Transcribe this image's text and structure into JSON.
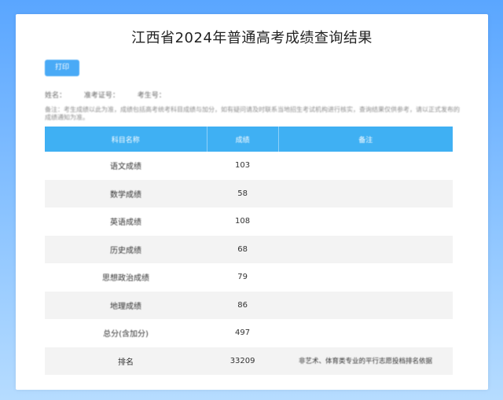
{
  "page": {
    "title": "江西省2024年普通高考成绩查询结果",
    "print_label": "打印",
    "info": {
      "name_label": "姓名：",
      "exam_no_label": "准考证号：",
      "id_label": "考生号："
    },
    "note": "备注：考生成绩以此为准，成绩包括高考统考科目成绩与加分，如有疑问请及时联系当地招生考试机构进行核实，查询结果仅供参考，请以正式发布的成绩通知为准。"
  },
  "table": {
    "headers": [
      "科目名称",
      "成绩",
      "备注"
    ],
    "rows": [
      {
        "subject": "语文成绩",
        "score": "103",
        "note": ""
      },
      {
        "subject": "数学成绩",
        "score": "58",
        "note": ""
      },
      {
        "subject": "英语成绩",
        "score": "108",
        "note": ""
      },
      {
        "subject": "历史成绩",
        "score": "68",
        "note": ""
      },
      {
        "subject": "思想政治成绩",
        "score": "79",
        "note": ""
      },
      {
        "subject": "地理成绩",
        "score": "86",
        "note": ""
      },
      {
        "subject": "总分(含加分)",
        "score": "497",
        "note": ""
      },
      {
        "subject": "排名",
        "score": "33209",
        "note": "非艺术、体育类专业的平行志愿投档排名依据"
      }
    ]
  }
}
